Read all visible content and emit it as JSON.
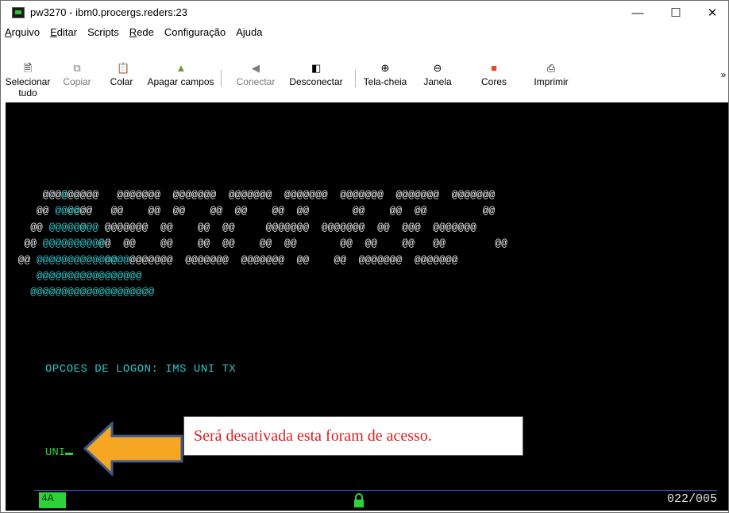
{
  "window": {
    "title": "pw3270 - ibm0.procergs.reders:23",
    "controls": {
      "minimize": "—",
      "maximize": "☐",
      "close": "✕"
    }
  },
  "menu": [
    {
      "label": "Arquivo",
      "underline": "A",
      "rest": "rquivo"
    },
    {
      "label": "Editar",
      "underline": "E",
      "rest": "ditar"
    },
    {
      "label": "Scripts",
      "underline": "",
      "rest": "Scripts"
    },
    {
      "label": "Rede",
      "underline": "R",
      "rest": "ede"
    },
    {
      "label": "Configuração",
      "underline": "",
      "rest": "Configuração"
    },
    {
      "label": "Ajuda",
      "underline": "",
      "rest": "Ajuda"
    }
  ],
  "toolbar": {
    "select_all": "Selecionar tudo",
    "copy": "Copiar",
    "paste": "Colar",
    "clear_fields": "Apagar campos",
    "connect": "Conectar",
    "disconnect": "Desconectar",
    "fullscreen": "Tela-cheia",
    "window": "Janela",
    "colors": "Cores",
    "print": "Imprimir",
    "overflow": "»"
  },
  "terminal": {
    "logon_options": "OPCOES DE LOGON: IMS UNI TX",
    "input_value": "UNI",
    "status_mode": "4A",
    "cursor_position": "022/005"
  },
  "callout": {
    "text": "Será desativada esta foram de acesso."
  },
  "colors": {
    "terminal_bg": "#000000",
    "teal": "#33c6c8",
    "green": "#2cd23a",
    "callout_text": "#e01e23",
    "arrow_fill": "#f5a623",
    "arrow_stroke": "#3f5a8a"
  }
}
